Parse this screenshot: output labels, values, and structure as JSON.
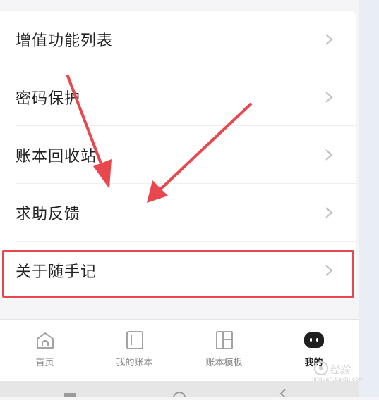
{
  "menu": {
    "items": [
      {
        "label": "增值功能列表"
      },
      {
        "label": "密码保护"
      },
      {
        "label": "账本回收站"
      },
      {
        "label": "求助反馈"
      },
      {
        "label": "关于随手记"
      }
    ],
    "highlighted_item": "关于随手记"
  },
  "annotation": {
    "color": "#e8474d"
  },
  "tabbar": {
    "tabs": [
      {
        "label": "首页",
        "icon": "home-icon",
        "active": false
      },
      {
        "label": "我的账本",
        "icon": "book-icon",
        "active": false
      },
      {
        "label": "账本模板",
        "icon": "template-icon",
        "active": false
      },
      {
        "label": "我的",
        "icon": "profile-icon",
        "active": true
      }
    ]
  },
  "watermark": {
    "text": "经验",
    "subtext": "jingyan.baidu.com"
  }
}
